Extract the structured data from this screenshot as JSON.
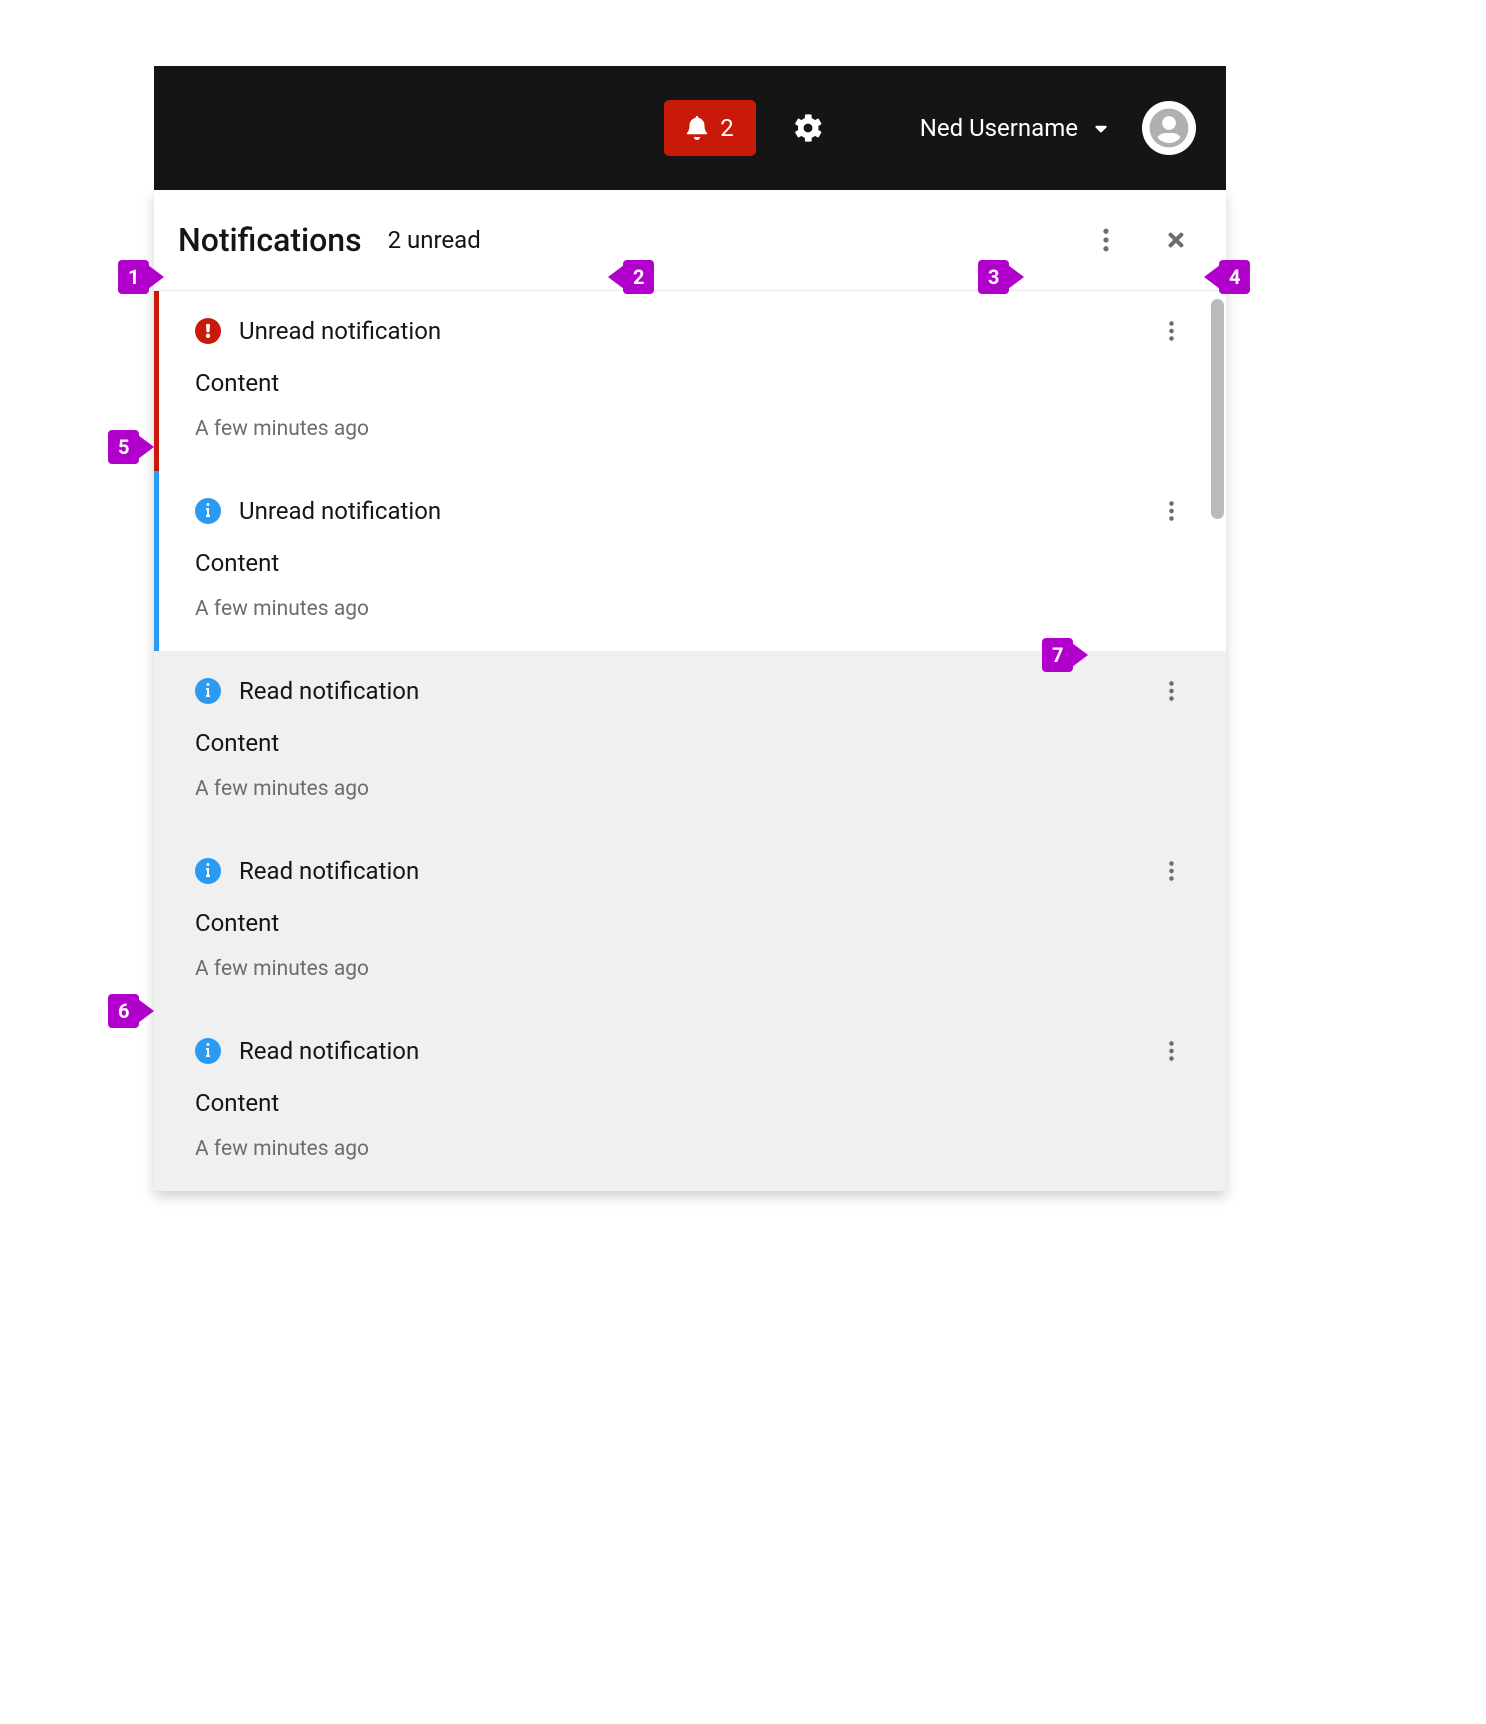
{
  "topbar": {
    "bell_count": "2",
    "username": "Ned Username"
  },
  "drawer": {
    "title": "Notifications",
    "unread_text": "2 unread"
  },
  "items": [
    {
      "status": "danger",
      "read": false,
      "title": "Unread notification",
      "body": "Content",
      "time": "A few minutes ago"
    },
    {
      "status": "info",
      "read": false,
      "title": "Unread notification",
      "body": "Content",
      "time": "A few minutes ago"
    },
    {
      "status": "info",
      "read": true,
      "title": "Read notification",
      "body": "Content",
      "time": "A few minutes ago"
    },
    {
      "status": "info",
      "read": true,
      "title": "Read notification",
      "body": "Content",
      "time": "A few minutes ago"
    },
    {
      "status": "info",
      "read": true,
      "title": "Read notification",
      "body": "Content",
      "time": "A few minutes ago"
    }
  ],
  "callouts": {
    "1": "1",
    "2": "2",
    "3": "3",
    "4": "4",
    "5": "5",
    "6": "6",
    "7": "7"
  }
}
